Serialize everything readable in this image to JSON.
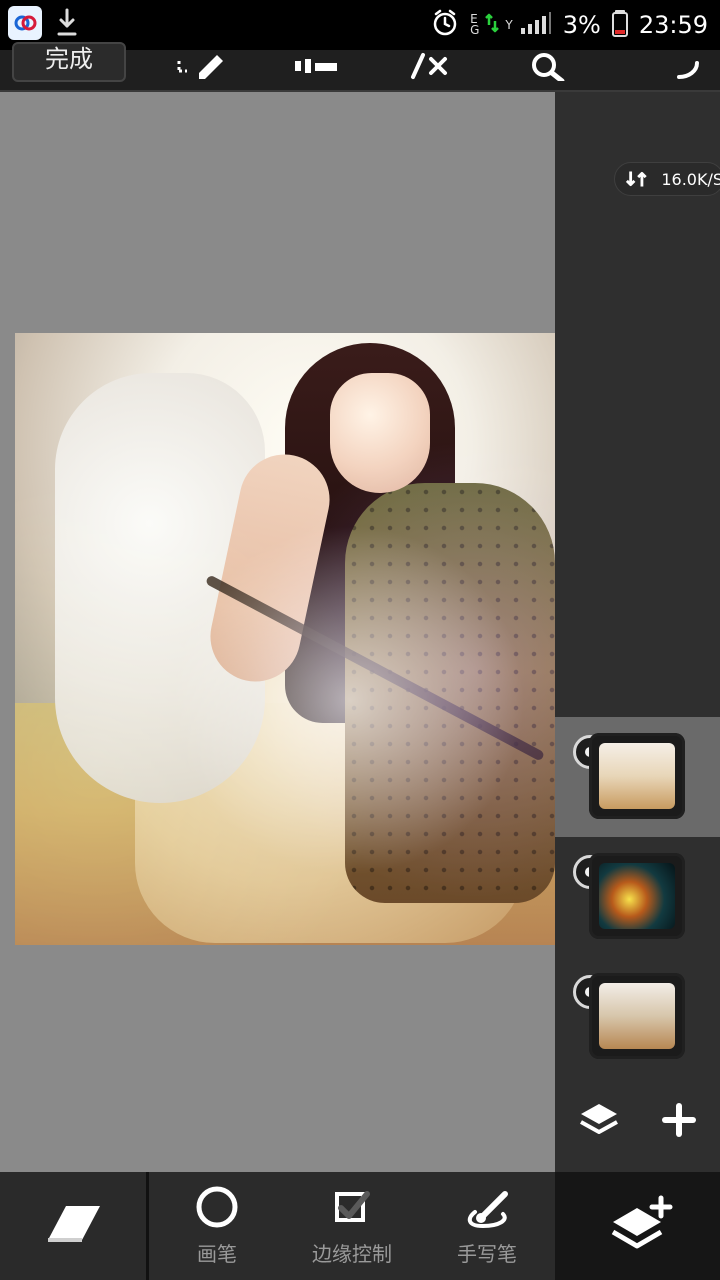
{
  "statusbar": {
    "battery_text": "3%",
    "time_text": "23:59",
    "network": {
      "e_label": "E",
      "g_label": "G",
      "signal_label": "Y"
    }
  },
  "topbar": {
    "done_label": "完成"
  },
  "right_panel": {
    "network_speed": "16.0K/S",
    "layers": [
      {
        "name": "layer-1",
        "selected": true
      },
      {
        "name": "layer-2",
        "selected": false
      },
      {
        "name": "layer-3",
        "selected": false
      }
    ]
  },
  "bottombar": {
    "tools": [
      {
        "label": "画笔"
      },
      {
        "label": "边缘控制"
      },
      {
        "label": "手写笔"
      }
    ]
  },
  "colors": {
    "statusbar_bg": "#000000",
    "canvas_bg": "#8a8a8a",
    "panel_bg": "#2f2f2f",
    "toolbar_bg": "#2b2b2b",
    "selected_layer_bg": "#6a6a6a"
  }
}
